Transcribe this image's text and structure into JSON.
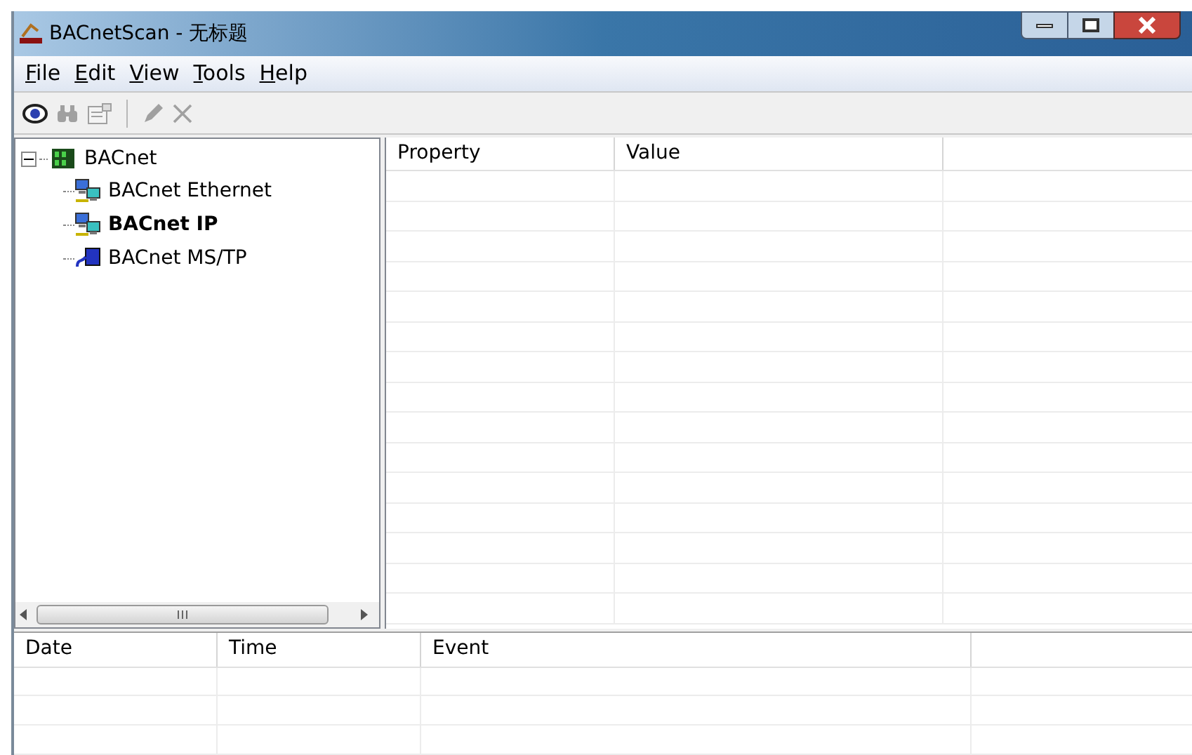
{
  "window": {
    "title": "BACnetScan - 无标题"
  },
  "menu": [
    {
      "label": "File"
    },
    {
      "label": "Edit"
    },
    {
      "label": "View"
    },
    {
      "label": "Tools"
    },
    {
      "label": "Help"
    }
  ],
  "toolbar": [
    {
      "kind": "eye",
      "disabled": false
    },
    {
      "kind": "binoculars",
      "disabled": true
    },
    {
      "kind": "properties",
      "disabled": true
    },
    {
      "kind": "separator"
    },
    {
      "kind": "pencil",
      "disabled": true
    },
    {
      "kind": "delete",
      "disabled": true
    }
  ],
  "tree": {
    "label": "BACnet",
    "expanded": true,
    "children": [
      {
        "label": "BACnet Ethernet",
        "kind": "network",
        "selected": false
      },
      {
        "label": "BACnet IP",
        "kind": "network",
        "selected": true
      },
      {
        "label": "BACnet MS/TP",
        "kind": "serial",
        "selected": false
      }
    ]
  },
  "property_table": {
    "columns": [
      "Property",
      "Value"
    ]
  },
  "event_table": {
    "columns": [
      "Date",
      "Time",
      "Event"
    ]
  }
}
